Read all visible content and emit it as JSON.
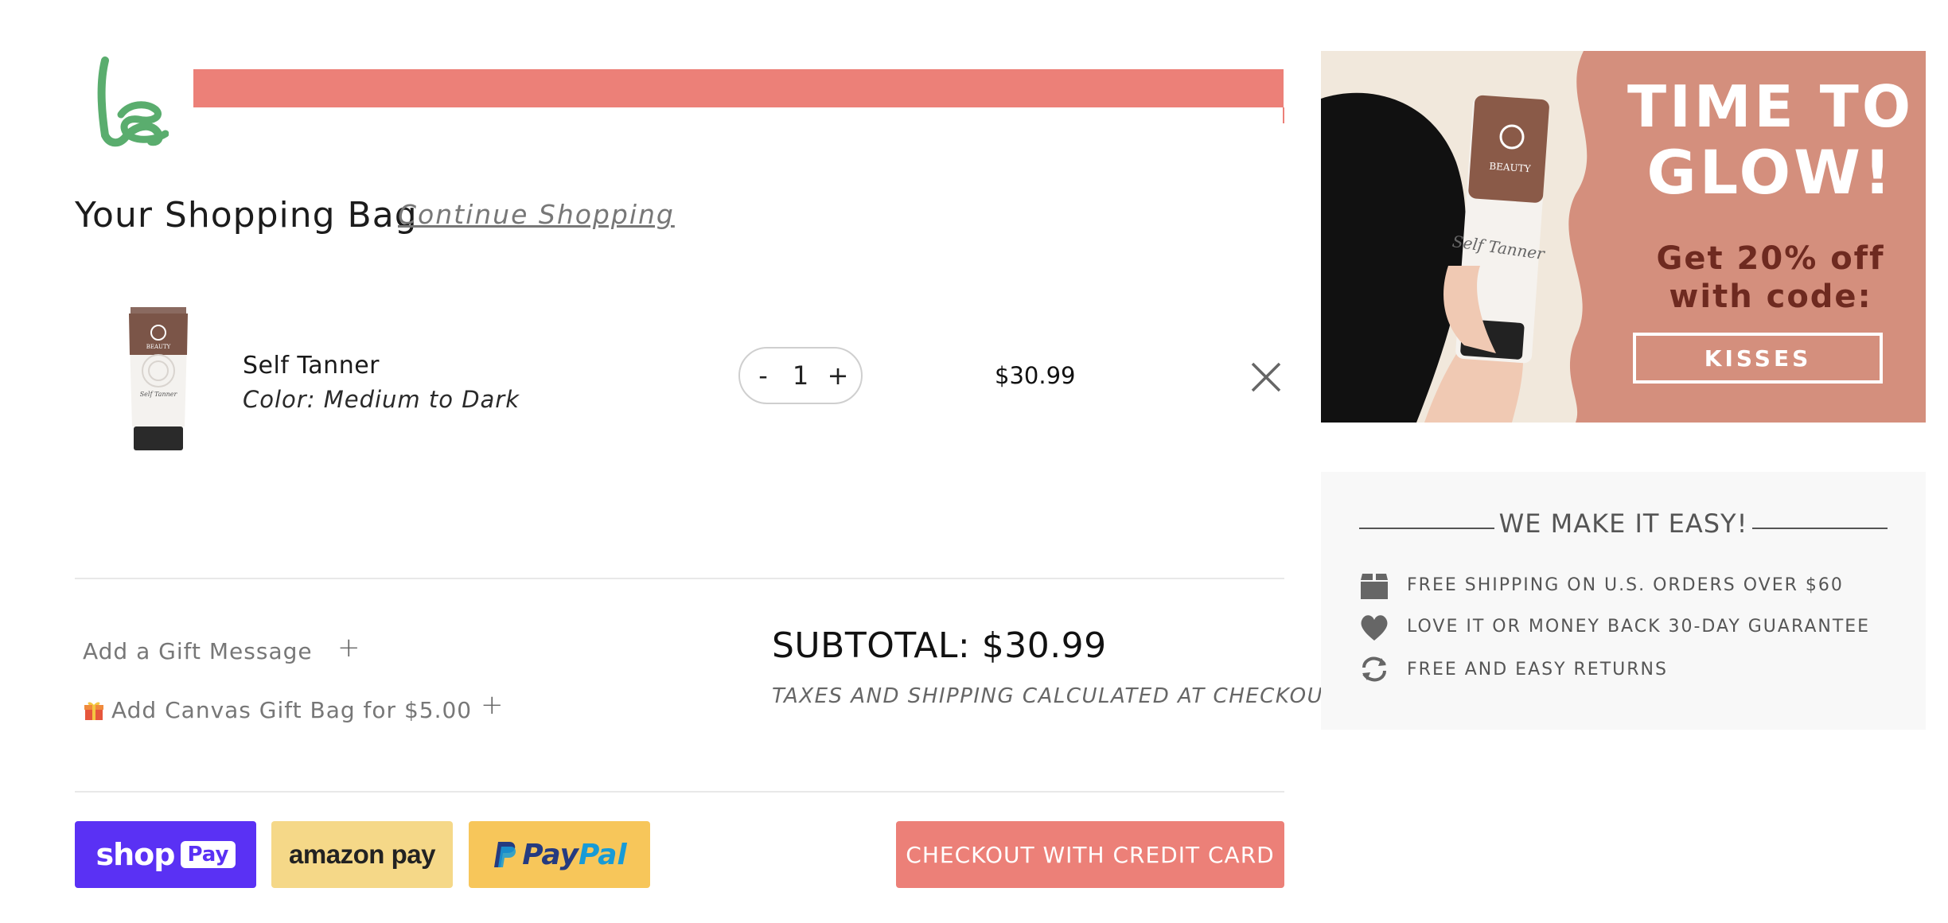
{
  "header": {
    "logo": "be",
    "progress": 1.0
  },
  "bag": {
    "title": "Your Shopping Bag",
    "continue_label": "Continue Shopping"
  },
  "item": {
    "name": "Self Tanner",
    "color": "Color: Medium to Dark",
    "quantity": "1",
    "minus": "-",
    "plus": "+",
    "price": "$30.99",
    "image_brand": "BEAUTY",
    "image_label": "Self Tanner"
  },
  "extras": {
    "gift_message": "Add a Gift Message",
    "gift_bag": "Add Canvas Gift Bag for $5.00",
    "gift_icon": "gift-icon",
    "plus": "+"
  },
  "totals": {
    "subtotal": "SUBTOTAL: $30.99",
    "note": "TAXES AND SHIPPING CALCULATED AT CHECKOUT"
  },
  "payment": {
    "shop_pay_word": "shop",
    "shop_pay_badge": "Pay",
    "amazon_pay": "amazon pay",
    "paypal_pay": "Pay",
    "paypal_pal": "Pal",
    "checkout": "CHECKOUT WITH CREDIT CARD"
  },
  "promo": {
    "line1": "TIME TO",
    "line2": "GLOW!",
    "line3": "Get 20% off",
    "line4": "with code:",
    "code": "KISSES",
    "product_label": "Self Tanner",
    "product_brand": "BEAUTY"
  },
  "easy": {
    "title": "WE MAKE IT EASY!",
    "items": [
      {
        "icon": "box-icon",
        "text": "FREE SHIPPING ON U.S. ORDERS OVER $60"
      },
      {
        "icon": "heart-icon",
        "text": "LOVE IT OR MONEY BACK 30-DAY GUARANTEE"
      },
      {
        "icon": "refresh-icon",
        "text": "FREE AND EASY RETURNS"
      }
    ]
  },
  "colors": {
    "accent": "#ec8078",
    "brand_green": "#5aad6e",
    "shop_pay": "#5a31f4",
    "amazon": "#f5d888",
    "paypal": "#f7c65a",
    "promo_bg": "#d48f7d"
  }
}
